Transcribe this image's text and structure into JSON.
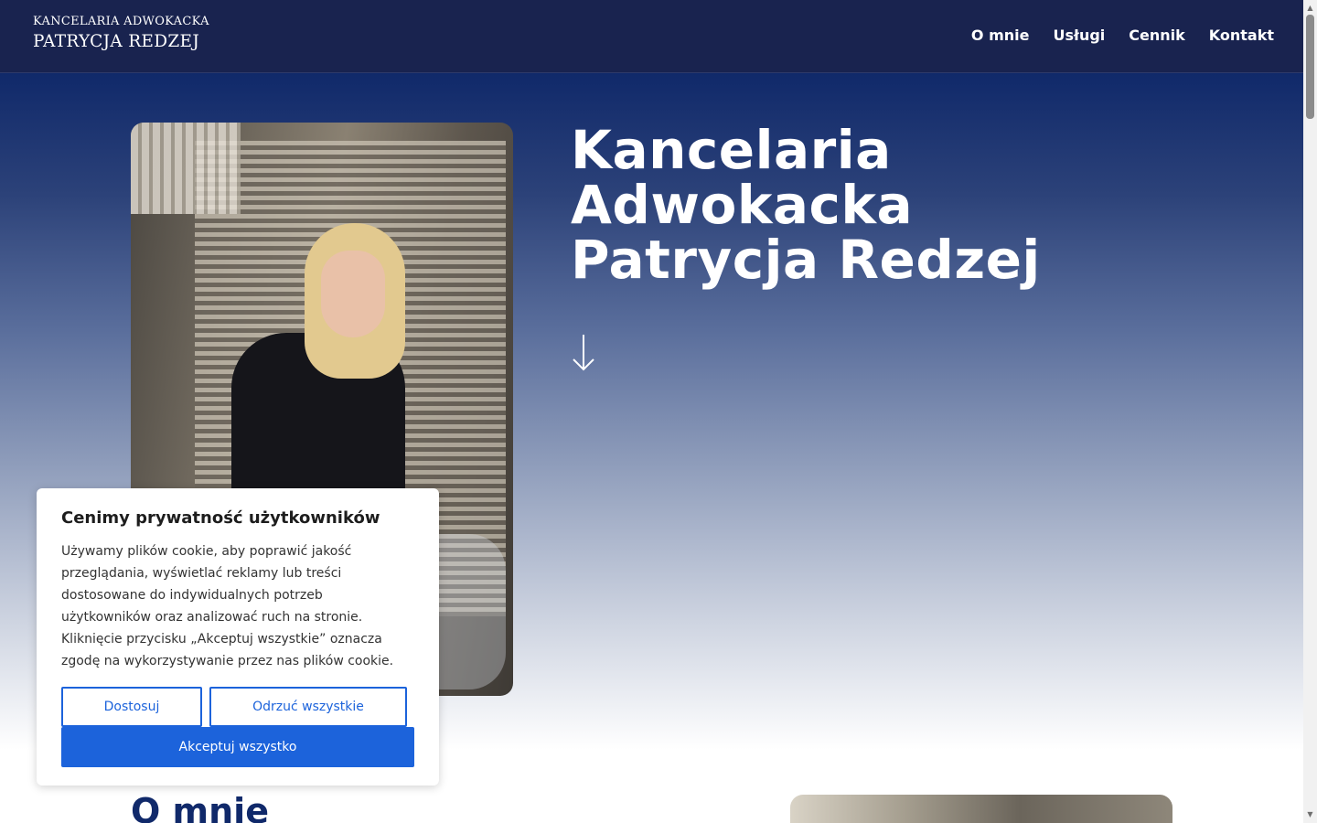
{
  "header": {
    "logo_line1": "KANCELARIA ADWOKACKA",
    "logo_line2": "PATRYCJA REDZEJ",
    "nav": [
      {
        "label": "O mnie"
      },
      {
        "label": "Usługi"
      },
      {
        "label": "Cennik"
      },
      {
        "label": "Kontakt"
      }
    ]
  },
  "hero": {
    "title_line1": "Kancelaria",
    "title_line2": "Adwokacka",
    "title_line3": "Patrycja Redzej",
    "arrow_icon": "arrow-down-icon"
  },
  "cookie_banner": {
    "title": "Cenimy prywatność użytkowników",
    "body": "Używamy plików cookie, aby poprawić jakość przeglądania, wyświetlać reklamy lub treści dostosowane do indywidualnych potrzeb użytkowników oraz analizować ruch na stronie. Kliknięcie przycisku „Akceptuj wszystkie” oznacza zgodę na wykorzystywanie przez nas plików cookie.",
    "customize_label": "Dostosuj",
    "reject_label": "Odrzuć wszystkie",
    "accept_label": "Akceptuj wszystko"
  },
  "about": {
    "title": "O mnie"
  },
  "colors": {
    "header_bg": "#19234f",
    "hero_top": "#10296a",
    "accent_blue": "#1c63db",
    "heading_navy": "#10296a"
  }
}
